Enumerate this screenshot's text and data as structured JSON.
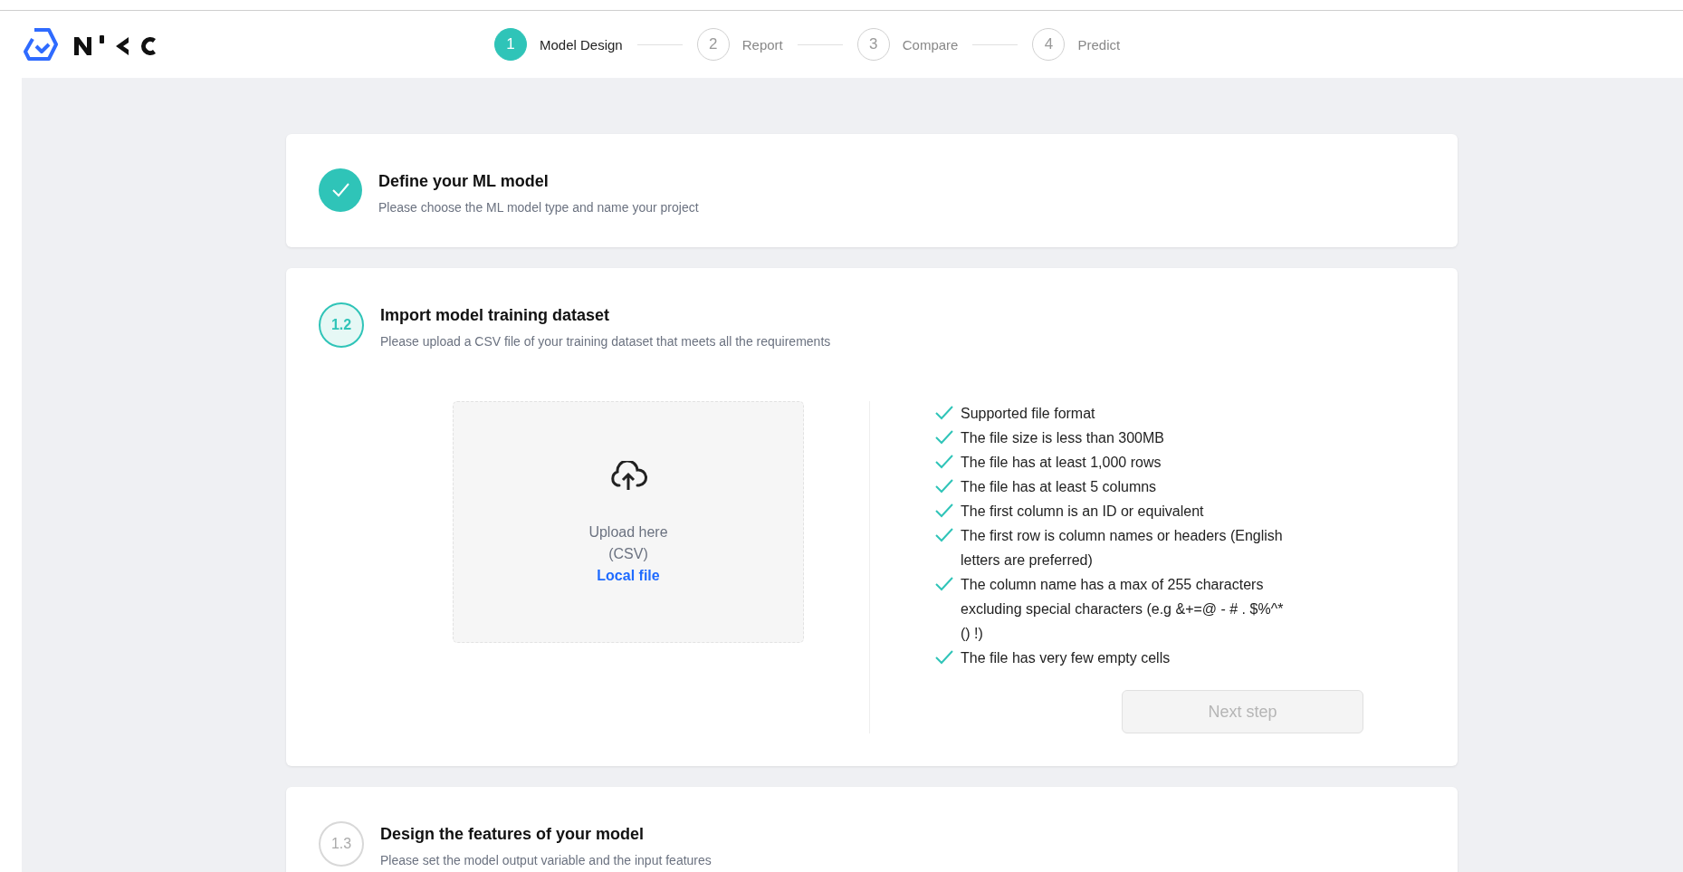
{
  "stepper": [
    {
      "number": "1",
      "label": "Model Design",
      "selected": true
    },
    {
      "number": "2",
      "label": "Report",
      "selected": false
    },
    {
      "number": "3",
      "label": "Compare",
      "selected": false
    },
    {
      "number": "4",
      "label": "Predict",
      "selected": false
    }
  ],
  "sections": [
    {
      "kind": "done",
      "title": "Define your ML model",
      "subtitle": "Please choose the ML model type and name your project"
    },
    {
      "kind": "active",
      "number": "1.2",
      "title": "Import model training dataset",
      "subtitle": "Please upload a CSV file of your training dataset that meets all the requirements"
    },
    {
      "kind": "pending",
      "number": "1.3",
      "title": "Design the features of your model",
      "subtitle": "Please set the model output variable and the input features"
    }
  ],
  "upload": {
    "label": "Upload here",
    "format": "(CSV)",
    "link": "Local file"
  },
  "requirements": [
    {
      "text": "Supported file format",
      "checked": true
    },
    {
      "text": "The file size is less than 300MB",
      "checked": true
    },
    {
      "text": "The file has at least 1,000 rows",
      "checked": true
    },
    {
      "text": "The file has at least 5 columns",
      "checked": true
    },
    {
      "text": "The first column is an ID or equivalent",
      "checked": true
    },
    {
      "text": "The first row is column names or headers (English letters are preferred)",
      "checked": true
    },
    {
      "text": "The column name has a max of 255 characters excluding special characters (e.g &+=@ - # . $%^*() !)",
      "checked": true
    },
    {
      "text": "The file has very few empty cells",
      "checked": true
    }
  ],
  "next_button": {
    "label": "Next step",
    "disabled": true
  }
}
